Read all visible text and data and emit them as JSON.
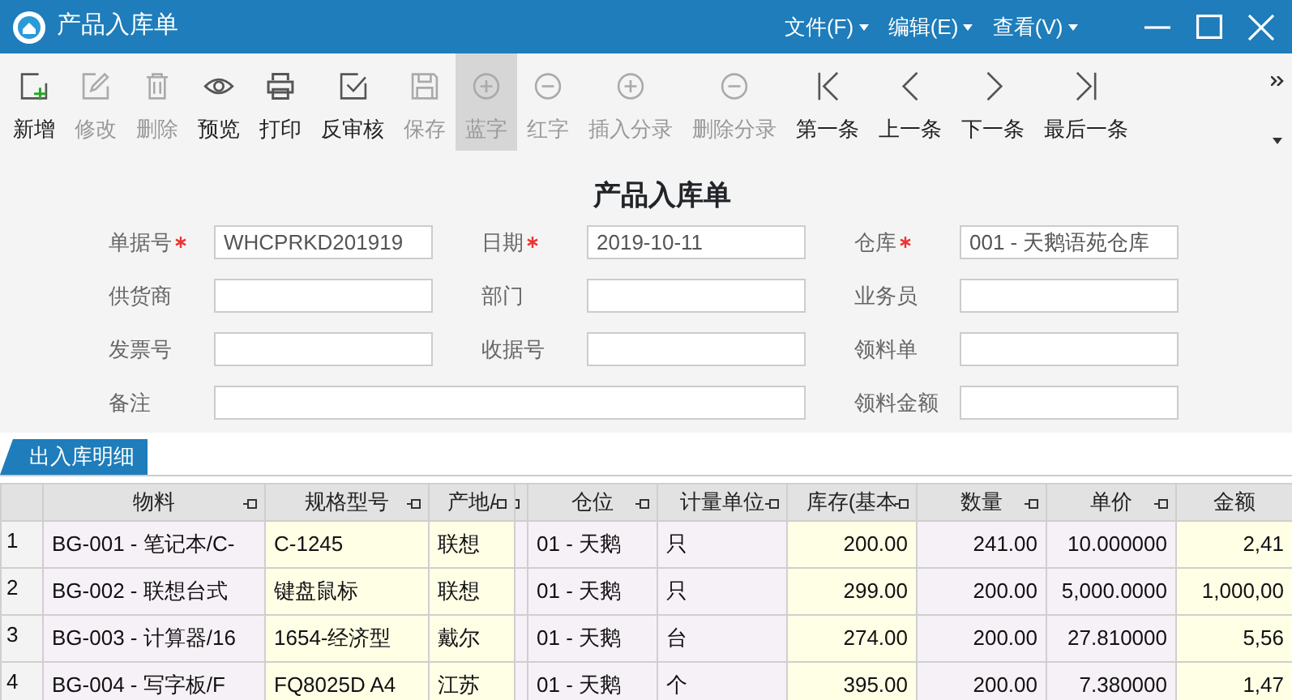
{
  "window": {
    "title": "产品入库单"
  },
  "menus": [
    {
      "label": "文件(F)"
    },
    {
      "label": "编辑(E)"
    },
    {
      "label": "查看(V)"
    }
  ],
  "toolbar": [
    {
      "label": "新增",
      "kind": "new",
      "disabled": false,
      "selected": false
    },
    {
      "label": "修改",
      "kind": "edit",
      "disabled": true,
      "selected": false
    },
    {
      "label": "删除",
      "kind": "delete",
      "disabled": true,
      "selected": false
    },
    {
      "label": "预览",
      "kind": "preview",
      "disabled": false,
      "selected": false
    },
    {
      "label": "打印",
      "kind": "print",
      "disabled": false,
      "selected": false
    },
    {
      "label": "反审核",
      "kind": "unaudit",
      "disabled": false,
      "selected": false
    },
    {
      "label": "保存",
      "kind": "save",
      "disabled": true,
      "selected": false
    },
    {
      "label": "蓝字",
      "kind": "plus",
      "disabled": true,
      "selected": true
    },
    {
      "label": "红字",
      "kind": "minus",
      "disabled": true,
      "selected": false
    },
    {
      "label": "插入分录",
      "kind": "plus",
      "disabled": true,
      "selected": false
    },
    {
      "label": "删除分录",
      "kind": "minus",
      "disabled": true,
      "selected": false
    },
    {
      "label": "第一条",
      "kind": "first",
      "disabled": false,
      "selected": false
    },
    {
      "label": "上一条",
      "kind": "prev",
      "disabled": false,
      "selected": false
    },
    {
      "label": "下一条",
      "kind": "next",
      "disabled": false,
      "selected": false
    },
    {
      "label": "最后一条",
      "kind": "last",
      "disabled": false,
      "selected": false
    }
  ],
  "form": {
    "title": "产品入库单",
    "rows": [
      [
        {
          "label": "单据号",
          "required": true,
          "value": "WHCPRKD201919"
        },
        {
          "label": "日期",
          "required": true,
          "value": "2019-10-11"
        },
        {
          "label": "仓库",
          "required": true,
          "value": "001 - 天鹅语苑仓库"
        }
      ],
      [
        {
          "label": "供货商",
          "required": false
        },
        {
          "label": "部门",
          "required": false
        },
        {
          "label": "业务员",
          "required": false
        }
      ],
      [
        {
          "label": "发票号",
          "required": false
        },
        {
          "label": "收据号",
          "required": false
        },
        {
          "label": "领料单",
          "required": false
        }
      ],
      [
        {
          "label": "备注",
          "required": false,
          "colspan": 2
        },
        {
          "label": "领料金额",
          "required": false
        }
      ]
    ]
  },
  "tabs": [
    {
      "label": "出入库明细",
      "selected": true
    }
  ],
  "table": {
    "columns": [
      {
        "label": "物料",
        "highlighted": false
      },
      {
        "label": "规格型号",
        "highlighted": true
      },
      {
        "label": "产地/",
        "highlighted": true
      },
      {
        "highlighted": false
      },
      {
        "label": "仓位",
        "highlighted": false
      },
      {
        "label": "计量单位",
        "highlighted": false
      },
      {
        "label": "库存(基本",
        "highlighted": true
      },
      {
        "label": "数量",
        "highlighted": false
      },
      {
        "label": "单价",
        "highlighted": false
      },
      {
        "label": "金额",
        "highlighted": true
      }
    ],
    "rows": [
      {
        "number": "1",
        "cells": [
          "BG-001 - 笔记本/C-",
          "C-1245",
          "联想",
          "",
          "01 - 天鹅",
          "只",
          "200.00",
          "241.00",
          "10.000000",
          "2,41"
        ]
      },
      {
        "number": "2",
        "cells": [
          "BG-002 - 联想台式",
          "键盘鼠标",
          "联想",
          "",
          "01 - 天鹅",
          "只",
          "299.00",
          "200.00",
          "5,000.0000",
          "1,000,00"
        ]
      },
      {
        "number": "3",
        "cells": [
          "BG-003 - 计算器/16",
          "1654-经济型",
          "戴尔",
          "",
          "01 - 天鹅",
          "台",
          "274.00",
          "200.00",
          "27.810000",
          "5,56"
        ]
      },
      {
        "number": "4",
        "cells": [
          "BG-004 - 写字板/F",
          "FQ8025D A4",
          "江苏",
          "",
          "01 - 天鹅",
          "个",
          "395.00",
          "200.00",
          "7.380000",
          "1,47"
        ]
      }
    ]
  }
}
